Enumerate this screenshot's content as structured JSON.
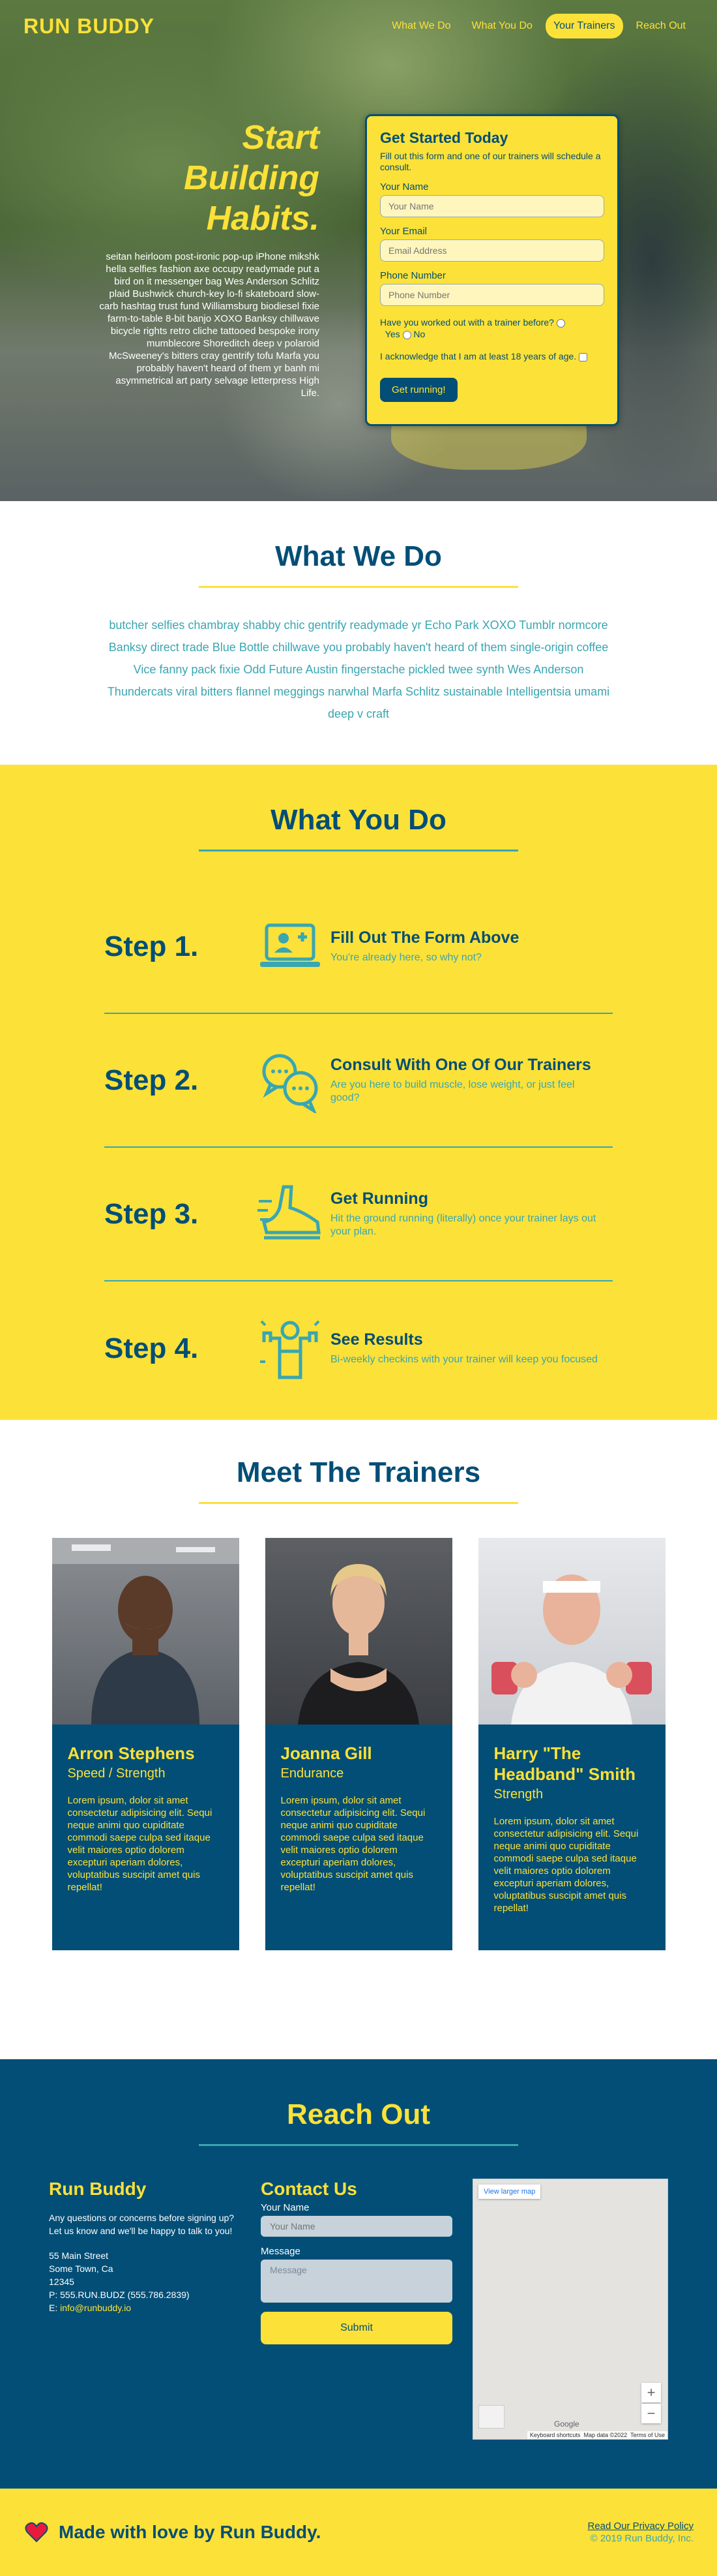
{
  "header": {
    "logo": "RUN BUDDY",
    "nav": [
      {
        "label": "What We Do",
        "active": false
      },
      {
        "label": "What You Do",
        "active": false
      },
      {
        "label": "Your Trainers",
        "active": true
      },
      {
        "label": "Reach Out",
        "active": false
      }
    ]
  },
  "hero": {
    "headline_1": "Start",
    "headline_2": "Building",
    "headline_3": "Habits.",
    "body": "seitan heirloom post-ironic pop-up iPhone mikshk hella selfies fashion axe occupy readymade put a bird on it messenger bag Wes Anderson Schlitz plaid Bushwick church-key lo-fi skateboard slow-carb hashtag trust fund Williamsburg biodiesel fixie farm-to-table 8-bit banjo XOXO Banksy chillwave bicycle rights retro cliche tattooed bespoke irony mumblecore Shoreditch deep v polaroid McSweeney's bitters cray gentrify tofu Marfa you probably haven't heard of them yr banh mi asymmetrical art party selvage letterpress High Life."
  },
  "signup_form": {
    "title": "Get Started Today",
    "subtitle": "Fill out this form and one of our trainers will schedule a consult.",
    "name_label": "Your Name",
    "name_placeholder": "Your Name",
    "email_label": "Your Email",
    "email_placeholder": "Email Address",
    "phone_label": "Phone Number",
    "phone_placeholder": "Phone Number",
    "trainer_question": "Have you worked out with a trainer before?",
    "yes_label": "Yes",
    "no_label": "No",
    "age_ack": "I acknowledge that I am at least 18 years of age.",
    "submit_label": "Get running!"
  },
  "what_we_do": {
    "title": "What We Do",
    "body": "butcher selfies chambray shabby chic gentrify readymade yr Echo Park XOXO Tumblr normcore Banksy direct trade Blue Bottle chillwave you probably haven't heard of them single-origin coffee Vice fanny pack fixie Odd Future Austin fingerstache pickled twee synth Wes Anderson Thundercats viral bitters flannel meggings narwhal Marfa Schlitz sustainable Intelligentsia umami deep v craft"
  },
  "what_you_do": {
    "title": "What You Do",
    "steps": [
      {
        "num": "Step 1.",
        "title": "Fill Out The Form Above",
        "desc": "You're already here, so why not?",
        "icon": "laptop-add-user-icon"
      },
      {
        "num": "Step 2.",
        "title": "Consult With One Of Our Trainers",
        "desc": "Are you here to build muscle, lose weight, or just feel good?",
        "icon": "chat-bubbles-icon"
      },
      {
        "num": "Step 3.",
        "title": "Get Running",
        "desc": "Hit the ground running (literally) once your trainer lays out your plan.",
        "icon": "running-shoe-icon"
      },
      {
        "num": "Step 4.",
        "title": "See Results",
        "desc": "Bi-weekly checkins with your trainer will keep you focused",
        "icon": "strong-person-icon"
      }
    ]
  },
  "trainers": {
    "title": "Meet The Trainers",
    "list": [
      {
        "name": "Arron Stephens",
        "role": "Speed / Strength",
        "bio": "Lorem ipsum, dolor sit amet consectetur adipisicing elit. Sequi neque animi quo cupiditate commodi saepe culpa sed itaque velit maiores optio dolorem excepturi aperiam dolores, voluptatibus suscipit amet quis repellat!"
      },
      {
        "name": "Joanna Gill",
        "role": "Endurance",
        "bio": "Lorem ipsum, dolor sit amet consectetur adipisicing elit. Sequi neque animi quo cupiditate commodi saepe culpa sed itaque velit maiores optio dolorem excepturi aperiam dolores, voluptatibus suscipit amet quis repellat!"
      },
      {
        "name": "Harry \"The Headband\" Smith",
        "role": "Strength",
        "bio": "Lorem ipsum, dolor sit amet consectetur adipisicing elit. Sequi neque animi quo cupiditate commodi saepe culpa sed itaque velit maiores optio dolorem excepturi aperiam dolores, voluptatibus suscipit amet quis repellat!"
      }
    ]
  },
  "reach_out": {
    "title": "Reach Out",
    "company": "Run Buddy",
    "intro_1": "Any questions or concerns before signing up?",
    "intro_2": "Let us know and we'll be happy to talk to you!",
    "address_1": "55 Main Street",
    "address_2": "Some Town, Ca",
    "zip": "12345",
    "phone": "P: 555.RUN.BUDZ (555.786.2839)",
    "email_prefix": "E: ",
    "email": "info@runbuddy.io",
    "contact_title": "Contact Us",
    "name_label": "Your Name",
    "name_placeholder": "Your Name",
    "message_label": "Message",
    "message_placeholder": "Message",
    "submit_label": "Submit",
    "map": {
      "larger_map": "View larger map",
      "zoom_in": "+",
      "zoom_out": "−",
      "google": "Google",
      "keyboard": "Keyboard shortcuts",
      "mapdata": "Map data ©2022",
      "terms": "Terms of Use"
    }
  },
  "footer": {
    "made_with": "Made with love by Run Buddy.",
    "privacy": "Read Our Privacy Policy",
    "copyright": "© 2019 Run Buddy, Inc."
  },
  "colors": {
    "navy": "#024e76",
    "yellow": "#fce138",
    "teal": "#39a6b2"
  }
}
